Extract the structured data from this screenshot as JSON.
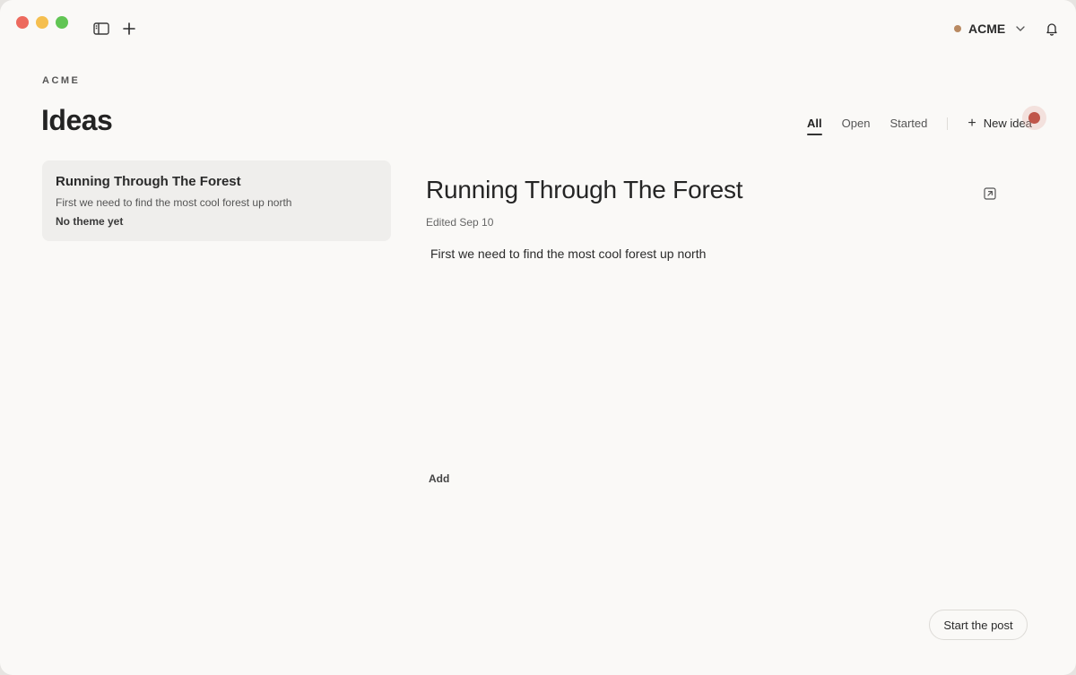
{
  "titlebar": {
    "workspace_name": "ACME",
    "workspace_dot_color": "#b98a62"
  },
  "header": {
    "org_label": "ACME",
    "title": "Ideas"
  },
  "tabs": [
    {
      "label": "All",
      "active": true
    },
    {
      "label": "Open",
      "active": false
    },
    {
      "label": "Started",
      "active": false
    }
  ],
  "new_idea_label": "New idea",
  "ideas": [
    {
      "title": "Running Through The Forest",
      "description": "First we need to find the most cool forest up north",
      "theme": "No theme yet"
    }
  ],
  "detail": {
    "title": "Running Through The Forest",
    "edited": "Edited Sep 10",
    "body": "First we need to find the most cool forest up north",
    "add_label": "Add",
    "start_label": "Start the post"
  },
  "icons": {
    "sidebar": "sidebar-toggle-icon",
    "plus": "plus-icon",
    "chevron": "chevron-down-icon",
    "bell": "bell-icon",
    "open": "open-external-icon"
  }
}
